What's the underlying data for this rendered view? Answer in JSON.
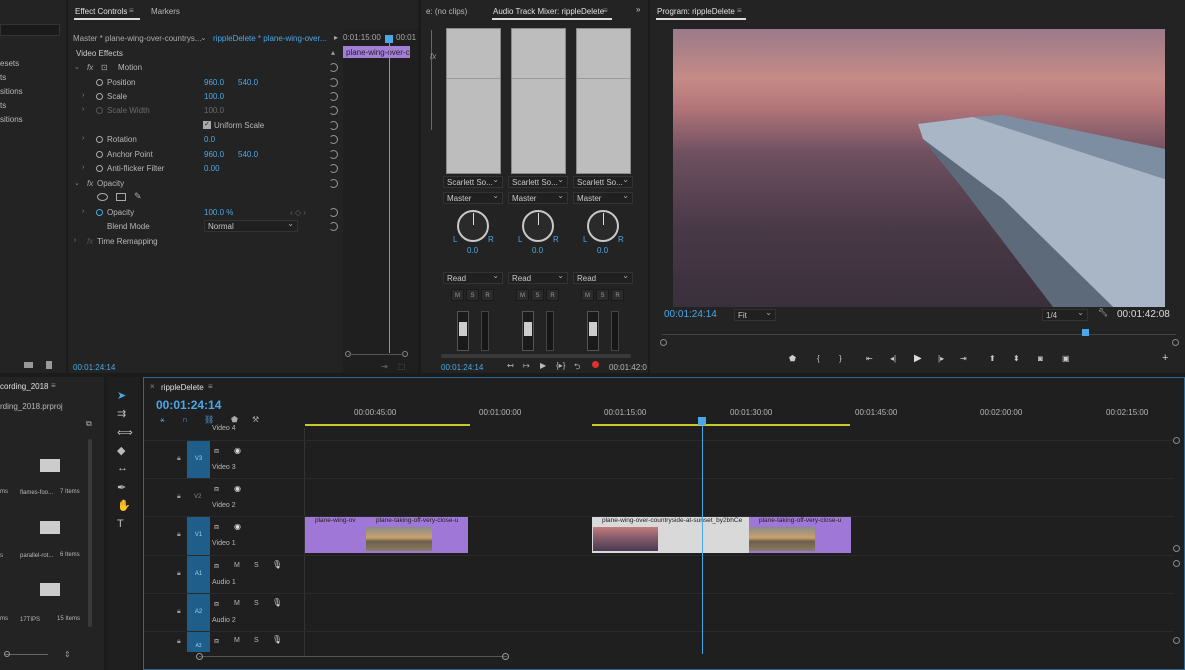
{
  "left_panel": {
    "items": [
      "esets",
      "ts",
      "sitions",
      "ts",
      "sitions"
    ]
  },
  "effect_controls": {
    "tab_effect_controls": "Effect Controls",
    "tab_markers": "Markers",
    "source": "Master * plane-wing-over-countrys...",
    "sequence": "rippleDelete * plane-wing-over...",
    "mini_time_1": "0:01:15:00",
    "mini_time_2": "00:01",
    "mini_clip": "plane-wing-over-c",
    "video_effects": "Video Effects",
    "motion": "Motion",
    "position": "Position",
    "position_x": "960.0",
    "position_y": "540.0",
    "scale": "Scale",
    "scale_val": "100.0",
    "scale_width": "Scale Width",
    "scale_width_val": "100.0",
    "uniform_scale": "Uniform Scale",
    "rotation": "Rotation",
    "rotation_val": "0.0",
    "anchor_point": "Anchor Point",
    "anchor_x": "960.0",
    "anchor_y": "540.0",
    "antiflicker": "Anti-flicker Filter",
    "antiflicker_val": "0.00",
    "opacity": "Opacity",
    "opacity_val": "100.0 %",
    "blend_mode": "Blend Mode",
    "blend_val": "Normal",
    "time_remap": "Time Remapping",
    "timecode": "00:01:24:14"
  },
  "mixer": {
    "tab_clips": "e: (no clips)",
    "tab_mixer": "Audio Track Mixer: rippleDelete",
    "device": "Scarlett So...",
    "master": "Master",
    "pan_val": "0.0",
    "read": "Read",
    "L": "L",
    "R": "R",
    "M": "M",
    "S": "S",
    "Rb": "R",
    "timecode": "00:01:24:14",
    "end_time": "00:01:42:0"
  },
  "program": {
    "title": "Program: rippleDelete",
    "timecode": "00:01:24:14",
    "fit": "Fit",
    "res": "1/4",
    "duration": "00:01:42:08"
  },
  "project": {
    "title": "cording_2018",
    "file": "rding_2018.prproj",
    "bins": [
      {
        "name": "flames-foo...",
        "count": "7 Items",
        "side": "ms"
      },
      {
        "name": "parallel-rot...",
        "count": "6 Items",
        "side": "s"
      },
      {
        "name": "17TIPS",
        "count": "15 Items",
        "side": "ms"
      }
    ]
  },
  "timeline": {
    "title": "rippleDelete",
    "timecode": "00:01:24:14",
    "ruler": [
      "00:00:45:00",
      "00:01:00:00",
      "00:01:15:00",
      "00:01:30:00",
      "00:01:45:00",
      "00:02:00:00",
      "00:02:15:00"
    ],
    "tracks": [
      {
        "id": "V4",
        "name": "Video 4"
      },
      {
        "id": "V3",
        "name": "Video 3"
      },
      {
        "id": "V2",
        "name": "Video 2"
      },
      {
        "id": "V1",
        "name": "Video 1"
      },
      {
        "id": "A1",
        "name": "Audio 1"
      },
      {
        "id": "A2",
        "name": "Audio 2"
      },
      {
        "id": "A3",
        "name": "A3"
      }
    ],
    "clips": [
      "plane-wing-ov",
      "plane-taking-off-very-close-u",
      "plane-wing-over-countryside-at-sunset_by2bhCe",
      "plane-taking-off-very-close-u"
    ],
    "M": "M",
    "S": "S"
  }
}
